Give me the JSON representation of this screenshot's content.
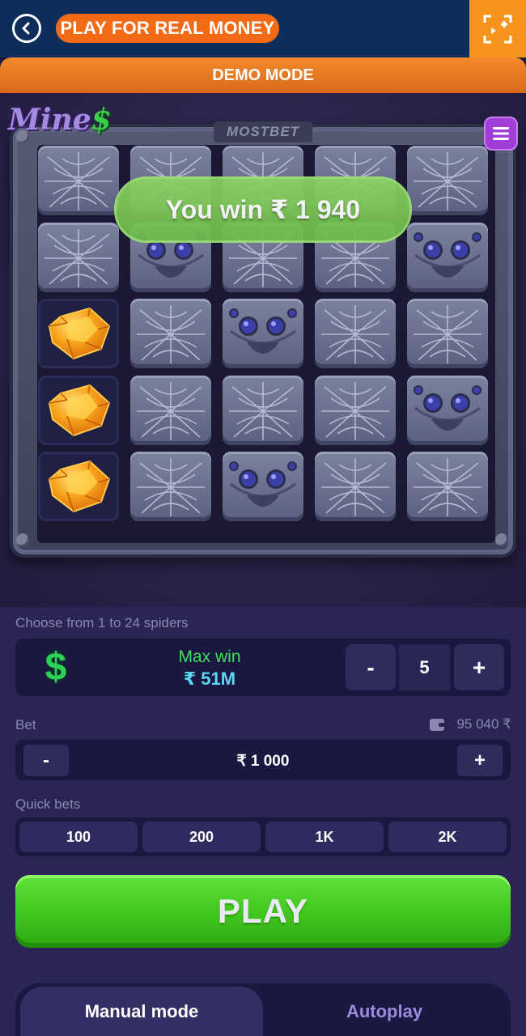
{
  "header": {
    "back_icon": "back-arrow-icon",
    "real_money_label": "PLAY FOR REAL MONEY",
    "fullscreen_icon": "fullscreen-icon"
  },
  "banner": {
    "demo_label": "DEMO MODE"
  },
  "game": {
    "logo_text": "Mine",
    "logo_dollar": "$",
    "brand": "MOSTBET",
    "menu_icon": "hamburger-menu-icon",
    "win_message": "You win ₹ 1 940",
    "grid": [
      [
        "web",
        "web",
        "web",
        "web",
        "web"
      ],
      [
        "web",
        "spider",
        "web",
        "web",
        "spider"
      ],
      [
        "gem",
        "web",
        "spider",
        "web",
        "web"
      ],
      [
        "gem",
        "web",
        "web",
        "web",
        "spider"
      ],
      [
        "gem",
        "web",
        "spider",
        "web",
        "web"
      ]
    ]
  },
  "controls": {
    "spiders_label": "Choose from 1 to 24 spiders",
    "max_win_label": "Max win",
    "max_win_value": "₹ 51M",
    "spider_count": "5",
    "minus": "-",
    "plus": "+",
    "bet_label": "Bet",
    "balance": "95 040 ₹",
    "bet_value": "₹  1 000",
    "quick_bets_label": "Quick bets",
    "quick_bets": [
      "100",
      "200",
      "1K",
      "2K"
    ],
    "play_label": "PLAY",
    "modes": [
      "Manual mode",
      "Autoplay"
    ],
    "colors": {
      "play": "#3ec21c",
      "accent": "#f36a16",
      "max_win": "#3de25a"
    }
  }
}
